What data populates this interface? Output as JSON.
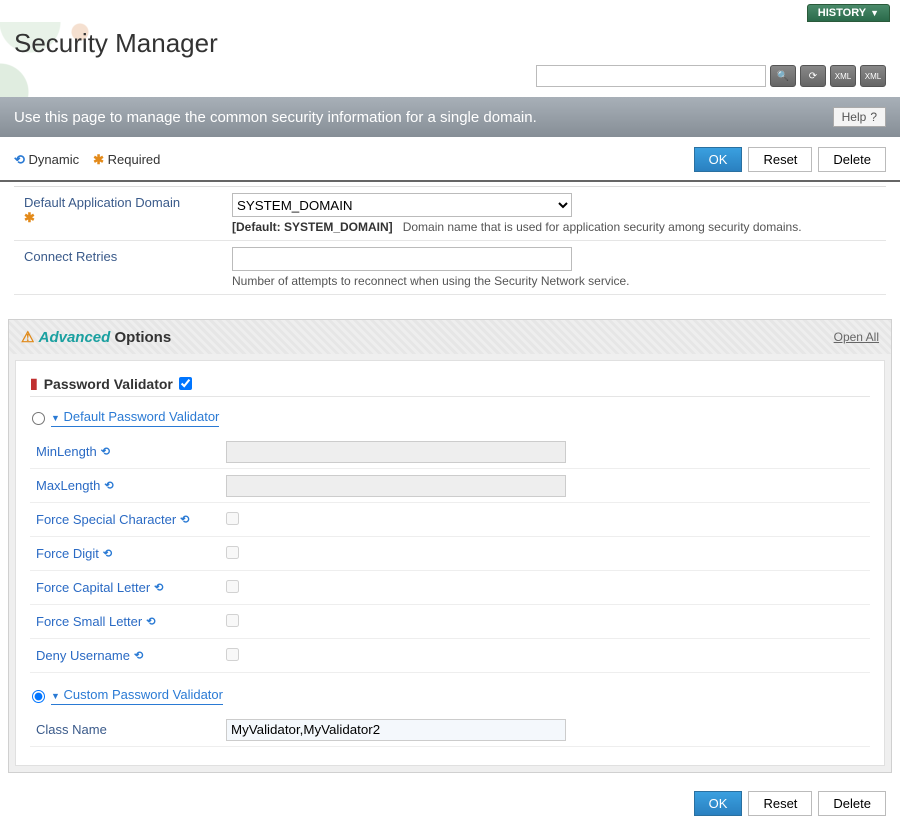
{
  "topbar": {
    "history": "HISTORY"
  },
  "page_title": "Security Manager",
  "instruction": "Use this page to manage the common security information for a single domain.",
  "help_label": "Help",
  "legend": {
    "dynamic": "Dynamic",
    "required": "Required"
  },
  "buttons": {
    "ok": "OK",
    "reset": "Reset",
    "delete": "Delete"
  },
  "fields": {
    "domain": {
      "label": "Default Application Domain",
      "value": "SYSTEM_DOMAIN",
      "default_prefix": "[Default: SYSTEM_DOMAIN]",
      "hint": "Domain name that is used for application security among security domains."
    },
    "retries": {
      "label": "Connect Retries",
      "value": "",
      "hint": "Number of attempts to reconnect when using the Security Network service."
    }
  },
  "advanced": {
    "advanced_word": "Advanced",
    "options_word": " Options",
    "open_all": "Open All",
    "password_validator": "Password Validator",
    "radios": {
      "default": "Default Password Validator",
      "custom": "Custom Password Validator"
    },
    "rows": {
      "minlength": "MinLength",
      "maxlength": "MaxLength",
      "force_special": "Force Special Character",
      "force_digit": "Force Digit",
      "force_capital": "Force Capital Letter",
      "force_small": "Force Small Letter",
      "deny_username": "Deny Username",
      "class_name": "Class Name"
    },
    "class_name_value": "MyValidator,MyValidator2"
  }
}
